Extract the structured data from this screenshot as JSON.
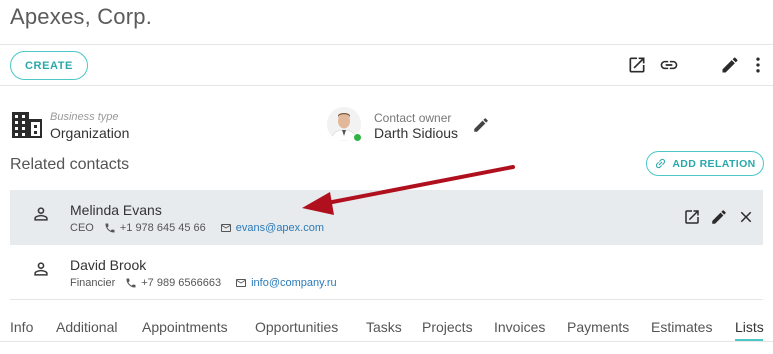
{
  "page": {
    "title": "Apexes, Corp."
  },
  "toolbar": {
    "create_label": "CREATE",
    "icons": [
      "open-external-icon",
      "link-icon",
      "pencil-icon",
      "more-vert-icon"
    ]
  },
  "business": {
    "label": "Business type",
    "value": "Organization"
  },
  "owner": {
    "label": "Contact owner",
    "value": "Darth Sidious",
    "status_color": "#2fb344"
  },
  "related": {
    "title": "Related contacts",
    "add_label": "ADD RELATION",
    "contacts": [
      {
        "name": "Melinda Evans",
        "role": "CEO",
        "phone": "+1 978 645 45 66",
        "email": "evans@apex.com"
      },
      {
        "name": "David Brook",
        "role": "Financier",
        "phone": "+7 989 6566663",
        "email": "info@company.ru"
      }
    ]
  },
  "tabs": [
    "Info",
    "Additional",
    "Appointments",
    "Opportunities",
    "Tasks",
    "Projects",
    "Invoices",
    "Payments",
    "Estimates",
    "Lists"
  ],
  "active_tab": "Lists",
  "colors": {
    "accent": "#4ec7c9",
    "link": "#2b7bb9",
    "arrow": "#b0101e",
    "selected_row": "#e8ebee"
  }
}
